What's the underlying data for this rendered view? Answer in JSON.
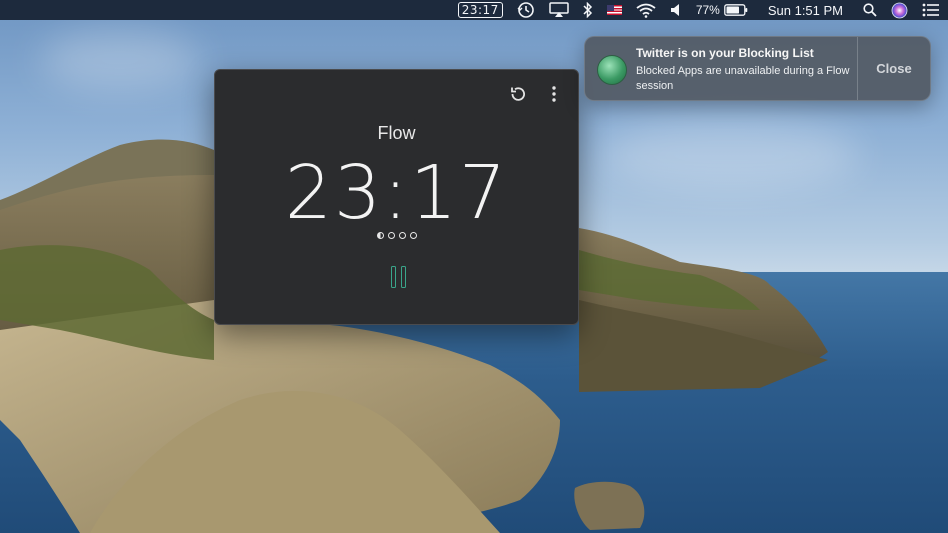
{
  "menubar": {
    "timer": "23:17",
    "battery": "77%",
    "clock": "Sun 1:51 PM"
  },
  "flow_window": {
    "title": "Flow",
    "time": "23:17",
    "session_count": 4,
    "current_session": 1
  },
  "notification": {
    "title": "Twitter is on your Blocking List",
    "message": "Blocked Apps are unavailable during a Flow session",
    "close_label": "Close"
  },
  "colors": {
    "accent": "#3aa58a",
    "menubar_bg": "#1d2a3d",
    "window_bg": "#2b2c2e"
  },
  "icons": [
    "time-machine-icon",
    "airplay-icon",
    "bluetooth-icon",
    "flag-icon",
    "wifi-icon",
    "volume-icon",
    "battery-icon",
    "search-icon",
    "siri-icon",
    "control-center-icon",
    "restart-icon",
    "more-icon",
    "pause-icon",
    "flow-app-icon"
  ]
}
